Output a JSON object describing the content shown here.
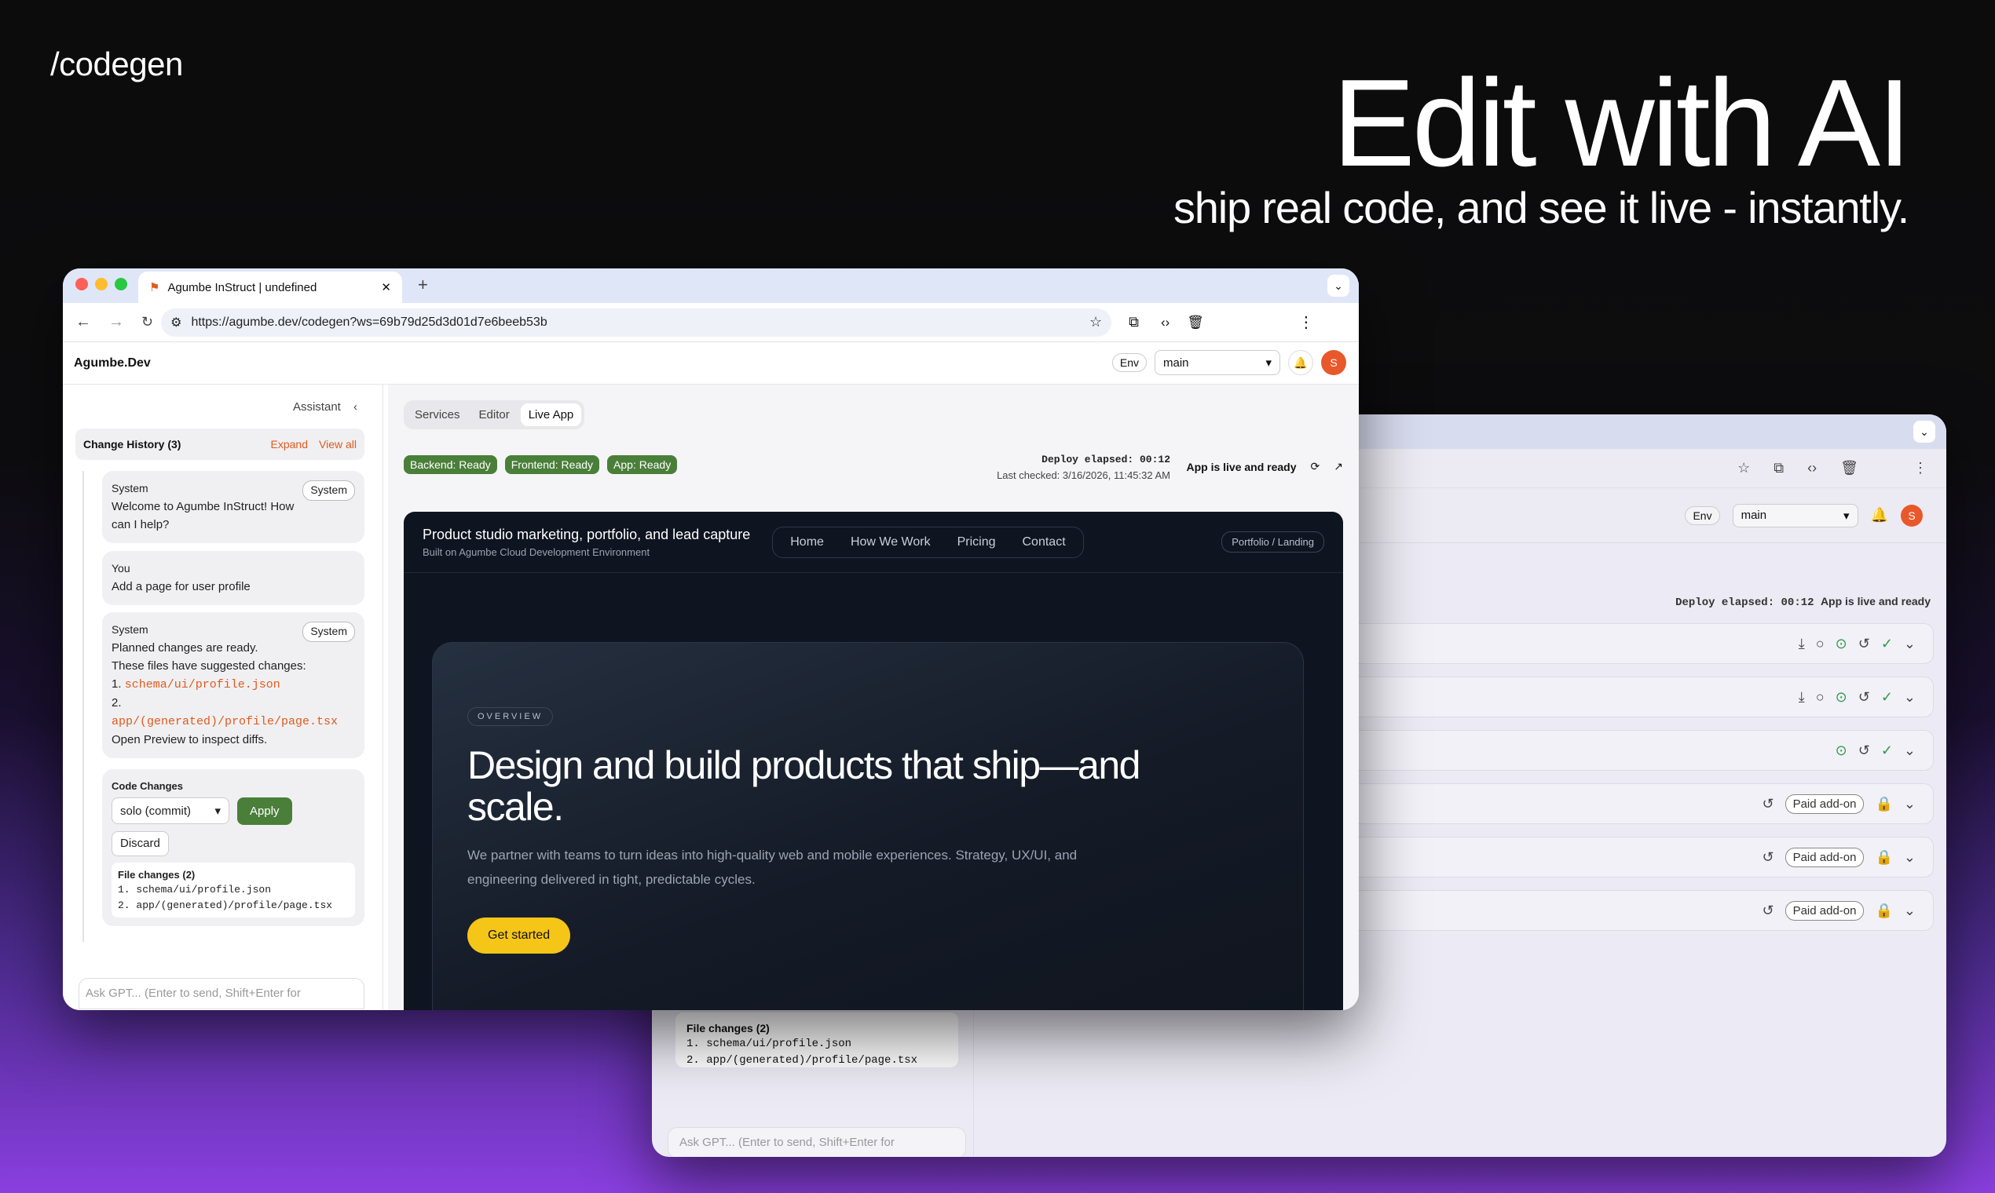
{
  "brand": "/codegen",
  "hero": {
    "title": "Edit with AI",
    "subtitle": "ship real code, and see it live - instantly."
  },
  "browser": {
    "tab_title": "Agumbe InStruct | undefined",
    "url": "https://agumbe.dev/codegen?ws=69b79d25d3d01d7e6beeb53b"
  },
  "app": {
    "name": "Agumbe.Dev",
    "env_label": "Env",
    "branch": "main",
    "avatar_initial": "S"
  },
  "sidebar": {
    "assistant_label": "Assistant",
    "history_title": "Change History (3)",
    "expand": "Expand",
    "view_all": "View all",
    "messages": [
      {
        "author": "System",
        "badge": "System",
        "text": "Welcome to Agumbe InStruct! How can I help?"
      },
      {
        "author": "You",
        "text": "Add a page for user profile"
      },
      {
        "author": "System",
        "badge": "System",
        "line1": "Planned changes are ready.",
        "line2": "These files have suggested changes:",
        "f1_num": "1.",
        "f1": "schema/ui/profile.json",
        "f2_num": "2.",
        "f2": "app/(generated)/profile/page.tsx",
        "line3": "Open Preview to inspect diffs."
      }
    ],
    "code_changes": {
      "title": "Code Changes",
      "mode": "solo (commit)",
      "apply": "Apply",
      "discard": "Discard",
      "files_title": "File changes (2)",
      "file1": "1. schema/ui/profile.json",
      "file2": "2. app/(generated)/profile/page.tsx"
    },
    "input_placeholder": "Ask GPT... (Enter to send, Shift+Enter for"
  },
  "main": {
    "tabs": [
      "Services",
      "Editor",
      "Live App"
    ],
    "status": [
      "Backend: Ready",
      "Frontend: Ready",
      "App: Ready"
    ],
    "deploy_elapsed": "Deploy elapsed: 00:12",
    "last_checked": "Last checked: 3/16/2026, 11:45:32 AM",
    "live_status": "App is live and ready"
  },
  "preview": {
    "site_title": "Product studio marketing, portfolio, and lead capture",
    "site_subtitle": "Built on Agumbe Cloud Development Environment",
    "nav": [
      "Home",
      "How We Work",
      "Pricing",
      "Contact"
    ],
    "tag": "Portfolio / Landing",
    "eyebrow": "OVERVIEW",
    "headline_1": "Design and build products that ship—and",
    "headline_2": "scale.",
    "body_1": "We partner with teams to turn ideas into high-quality web and mobile experiences. Strategy, UX/UI, and",
    "body_2": "engineering delivered in tight, predictable cycles.",
    "cta": "Get started"
  },
  "back_window": {
    "env_label": "Env",
    "branch": "main",
    "avatar_initial": "S",
    "deploy_elapsed": "Deploy elapsed: 00:12",
    "live_status": "App is live and ready",
    "paid_label": "Paid add-on",
    "files_title": "File changes (2)",
    "file1": "1. schema/ui/profile.json",
    "file2": "2. app/(generated)/profile/page.tsx",
    "input_placeholder": "Ask GPT... (Enter to send, Shift+Enter for"
  }
}
